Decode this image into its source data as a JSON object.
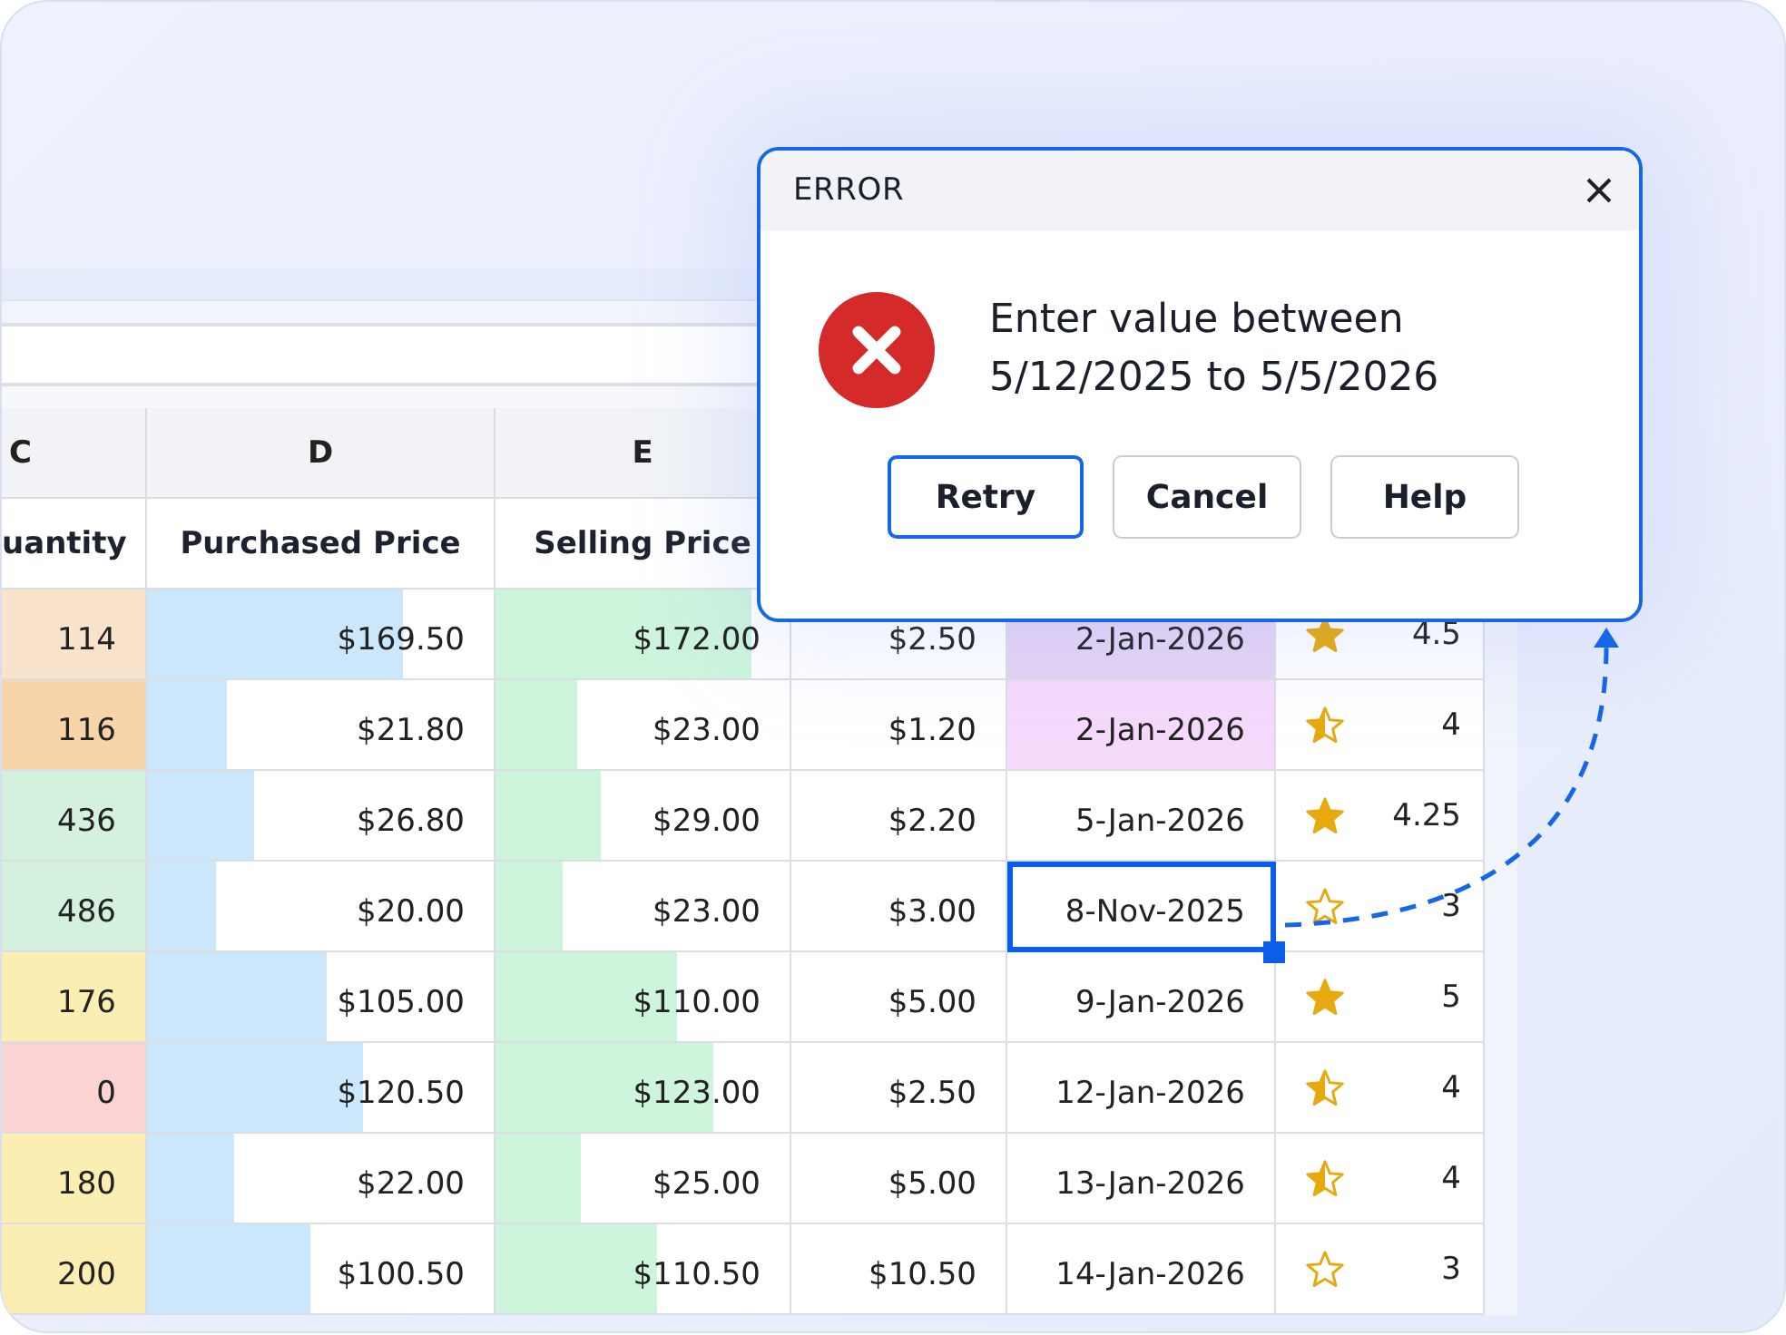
{
  "sheet": {
    "columns": [
      {
        "letter": "C",
        "header": "uantity"
      },
      {
        "letter": "D",
        "header": "Purchased Price"
      },
      {
        "letter": "E",
        "header": "Selling Price"
      }
    ],
    "rows": [
      {
        "quantity": {
          "text": "114",
          "color": "#f9e3cb"
        },
        "purchased": {
          "text": "$169.50",
          "level": 0.74
        },
        "selling": {
          "text": "$172.00",
          "level": 0.87
        },
        "column_f": "$2.50",
        "date": {
          "text": "2-Jan-2026",
          "color": "#e6d5f5",
          "selected": false
        },
        "rating": {
          "kind": "full",
          "text": "4.5"
        }
      },
      {
        "quantity": {
          "text": "116",
          "color": "#f8d5a8"
        },
        "purchased": {
          "text": "$21.80",
          "level": 0.23
        },
        "selling": {
          "text": "$23.00",
          "level": 0.28
        },
        "column_f": "$1.20",
        "date": {
          "text": "2-Jan-2026",
          "color": "#f6dafc",
          "selected": false
        },
        "rating": {
          "kind": "half",
          "text": "4"
        }
      },
      {
        "quantity": {
          "text": "436",
          "color": "#d3f1dc"
        },
        "purchased": {
          "text": "$26.80",
          "level": 0.31
        },
        "selling": {
          "text": "$29.00",
          "level": 0.36
        },
        "column_f": "$2.20",
        "date": {
          "text": "5-Jan-2026",
          "selected": false
        },
        "rating": {
          "kind": "full",
          "text": "4.25"
        }
      },
      {
        "quantity": {
          "text": "486",
          "color": "#d3f1dc"
        },
        "purchased": {
          "text": "$20.00",
          "level": 0.2
        },
        "selling": {
          "text": "$23.00",
          "level": 0.23
        },
        "column_f": "$3.00",
        "date": {
          "text": "8-Nov-2025",
          "selected": true
        },
        "rating": {
          "kind": "empty",
          "text": "3"
        }
      },
      {
        "quantity": {
          "text": "176",
          "color": "#fbeeb2"
        },
        "purchased": {
          "text": "$105.00",
          "level": 0.52
        },
        "selling": {
          "text": "$110.00",
          "level": 0.62
        },
        "column_f": "$5.00",
        "date": {
          "text": "9-Jan-2026",
          "selected": false
        },
        "rating": {
          "kind": "full",
          "text": "5"
        }
      },
      {
        "quantity": {
          "text": "0",
          "color": "#fcd3d3"
        },
        "purchased": {
          "text": "$120.50",
          "level": 0.625
        },
        "selling": {
          "text": "$123.00",
          "level": 0.74
        },
        "column_f": "$2.50",
        "date": {
          "text": "12-Jan-2026",
          "selected": false
        },
        "rating": {
          "kind": "half",
          "text": "4"
        }
      },
      {
        "quantity": {
          "text": "180",
          "color": "#fbeeb2"
        },
        "purchased": {
          "text": "$22.00",
          "level": 0.25
        },
        "selling": {
          "text": "$25.00",
          "level": 0.29
        },
        "column_f": "$5.00",
        "date": {
          "text": "13-Jan-2026",
          "selected": false
        },
        "rating": {
          "kind": "half",
          "text": "4"
        }
      },
      {
        "quantity": {
          "text": "200",
          "color": "#fbeeb2"
        },
        "purchased": {
          "text": "$100.50",
          "level": 0.47
        },
        "selling": {
          "text": "$110.50",
          "level": 0.55
        },
        "column_f": "$10.50",
        "date": {
          "text": "14-Jan-2026",
          "selected": false
        },
        "rating": {
          "kind": "empty",
          "text": "3"
        }
      }
    ]
  },
  "dialog": {
    "title": "ERROR",
    "message": "Enter value between 5/12/2025 to 5/5/2026",
    "buttons": [
      {
        "label": "Retry",
        "focused": true
      },
      {
        "label": "Cancel",
        "focused": false
      },
      {
        "label": "Help",
        "focused": false
      }
    ]
  }
}
